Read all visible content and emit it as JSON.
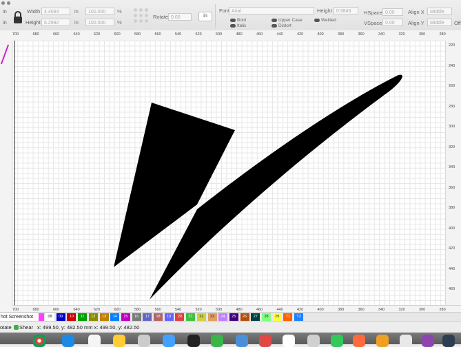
{
  "toolbar": {
    "in_label": "in",
    "width_label": "Width",
    "width_value": "4.4094",
    "width_unit": "in",
    "height_label": "Height",
    "height_value": "6.2992",
    "height_unit": "in",
    "scale_w_value": "100.000",
    "scale_h_value": "100.000",
    "percent": "%",
    "rotate_label": "Rotate",
    "rotate_value": "0.00",
    "in_button": "in",
    "font_label": "Font",
    "font_value": "Arial",
    "text_height_label": "Height",
    "text_height_value": "0.9843",
    "hspace_label": "HSpace",
    "hspace_value": "0.00",
    "vspace_label": "VSpace",
    "vspace_value": "0.00",
    "align_x_label": "Align X",
    "align_x_value": "Middle",
    "align_y_label": "Align Y",
    "align_y_value": "Middle",
    "offset_label": "Off",
    "bold_label": "Bold",
    "italic_label": "Italic",
    "upper_label": "Upper Case",
    "distort_label": "Distort",
    "welded_label": "Welded"
  },
  "ruler_top": [
    "700",
    "680",
    "660",
    "640",
    "620",
    "600",
    "580",
    "560",
    "540",
    "520",
    "500",
    "480",
    "460",
    "440",
    "420",
    "400",
    "380",
    "360",
    "340",
    "320",
    "300",
    "280"
  ],
  "ruler_bottom": [
    "700",
    "680",
    "660",
    "640",
    "620",
    "600",
    "580",
    "560",
    "540",
    "520",
    "500",
    "480",
    "460",
    "440",
    "420",
    "400",
    "380",
    "360",
    "340",
    "320",
    "300",
    "280"
  ],
  "ruler_right": [
    "220",
    "240",
    "260",
    "280",
    "300",
    "320",
    "340",
    "360",
    "380",
    "400",
    "420",
    "440",
    "460"
  ],
  "palette": {
    "screenshot_label": "hot Screenshot",
    "items": [
      {
        "label": "08",
        "color": "#ffffff"
      },
      {
        "label": "09",
        "color": "#0000c8"
      },
      {
        "label": "10",
        "color": "#c80000"
      },
      {
        "label": "11",
        "color": "#00a000"
      },
      {
        "label": "12",
        "color": "#8c8c00"
      },
      {
        "label": "13",
        "color": "#c08000"
      },
      {
        "label": "14",
        "color": "#0080ff"
      },
      {
        "label": "15",
        "color": "#c000c0"
      },
      {
        "label": "16",
        "color": "#7a7a7a"
      },
      {
        "label": "17",
        "color": "#6464c8"
      },
      {
        "label": "18",
        "color": "#b46464"
      },
      {
        "label": "19",
        "color": "#6464ff"
      },
      {
        "label": "20",
        "color": "#e04040"
      },
      {
        "label": "21",
        "color": "#40c040"
      },
      {
        "label": "22",
        "color": "#d0d040"
      },
      {
        "label": "23",
        "color": "#e0a060"
      },
      {
        "label": "24",
        "color": "#c080ff"
      },
      {
        "label": "25",
        "color": "#400080"
      },
      {
        "label": "26",
        "color": "#b05010"
      },
      {
        "label": "27",
        "color": "#004040"
      },
      {
        "label": "28",
        "color": "#80ff80"
      },
      {
        "label": "29",
        "color": "#ffff40"
      },
      {
        "label": "T1",
        "color": "#ff6000"
      },
      {
        "label": "T2",
        "color": "#2080ff"
      }
    ]
  },
  "status": {
    "rotate_label": "otate",
    "shear_label": "Shear",
    "coords_text": "x: 499.50, y: 482.50 mm  x: 499.50, y: 482.50"
  },
  "colors": {
    "shape_fill": "#000000",
    "dock_chrome_red": "#db4437",
    "dock_blue": "#1e88e5"
  }
}
